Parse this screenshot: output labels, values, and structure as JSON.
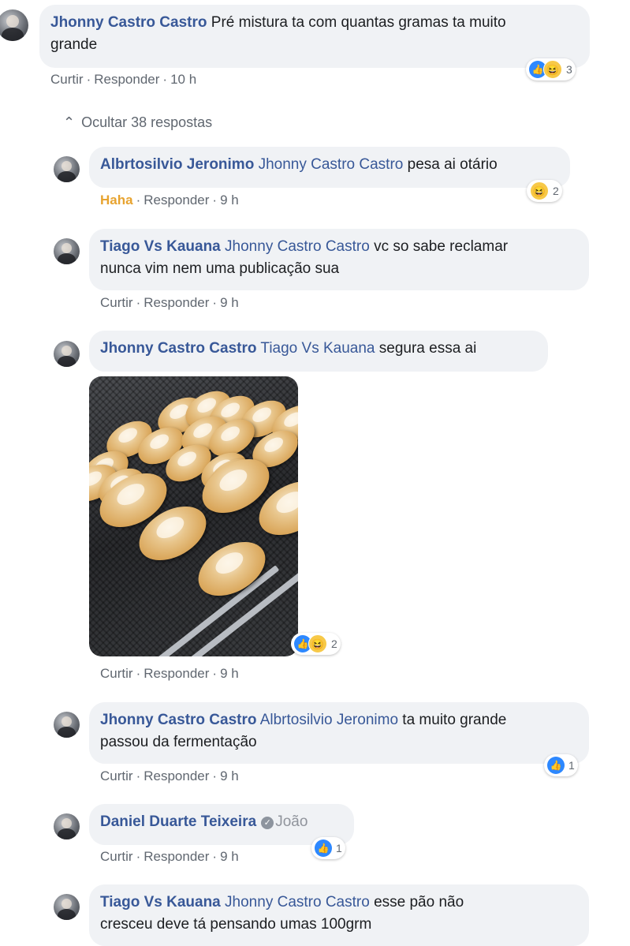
{
  "actions": {
    "like": "Curtir",
    "reply": "Responder",
    "haha": "Haha",
    "sep": "·"
  },
  "hide_replies": "Ocultar 38 respostas",
  "comments": [
    {
      "author": "Jhonny Castro Castro",
      "mention": "",
      "text_line1": "Pré mistura ta com quantas gramas ta muito",
      "text_line2": "grande",
      "time": "10 h",
      "reaction_count": "3"
    },
    {
      "author": "Albrtosilvio Jeronimo",
      "mention": "Jhonny Castro Castro",
      "text": "pesa ai otário",
      "time": "9 h",
      "reaction_count": "2"
    },
    {
      "author": "Tiago Vs Kauana",
      "mention": "Jhonny Castro Castro",
      "text_line1": "vc so sabe reclamar",
      "text_line2": "nunca vim nem uma publicação sua",
      "time": "9 h"
    },
    {
      "author": "Jhonny Castro Castro",
      "mention": "Tiago Vs Kauana",
      "text": "segura essa ai",
      "time": "9 h",
      "reaction_count": "2"
    },
    {
      "author": "Jhonny Castro Castro",
      "mention": "Albrtosilvio Jeronimo",
      "text_line1": "ta muito grande",
      "text_line2": "passou da fermentação",
      "time": "9 h",
      "reaction_count": "1"
    },
    {
      "author": "Daniel Duarte Teixeira",
      "page": "João",
      "time": "9 h",
      "reaction_count": "1"
    },
    {
      "author": "Tiago Vs Kauana",
      "mention": "Jhonny Castro Castro",
      "text_line1": "esse pão não",
      "text_line2": "cresceu deve tá pensando umas 100grm"
    }
  ]
}
